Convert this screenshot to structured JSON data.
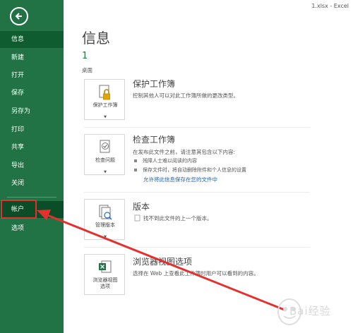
{
  "window": {
    "title": "1.xlsx - Excel"
  },
  "sidebar": {
    "items": [
      {
        "label": "信息"
      },
      {
        "label": "新建"
      },
      {
        "label": "打开"
      },
      {
        "label": "保存"
      },
      {
        "label": "另存为"
      },
      {
        "label": "打印"
      },
      {
        "label": "共享"
      },
      {
        "label": "导出"
      },
      {
        "label": "关闭"
      },
      {
        "label": "帐户"
      },
      {
        "label": "选项"
      }
    ]
  },
  "main": {
    "title": "信息",
    "file_name": "1",
    "file_location": "桌面",
    "sections": [
      {
        "button_label": "保护工作簿",
        "title": "保护工作簿",
        "description": "控制其他人可以对此工作簿所做的更改类型。"
      },
      {
        "button_label": "检查问题",
        "title": "检查工作簿",
        "description": "在发布此文件之前，请注意其包含以下内容:",
        "bullets": [
          "残障人士难以阅读的内容",
          "保存文件时，将自动删除附件和个人信息的设置"
        ],
        "link": "允许将此信息保存在您的文件中"
      },
      {
        "button_label": "管理版本",
        "title": "版本",
        "description": "找不到此文件的上一个版本。"
      },
      {
        "button_label_1": "浏览器视图",
        "button_label_2": "选项",
        "title": "浏览器视图选项",
        "description": "选择在 Web 上查看此工作簿时用户可以看到的内容。"
      }
    ]
  },
  "watermark": {
    "text": "Bai经验"
  },
  "colors": {
    "sidebar": "#217346",
    "annotation": "#e3312f",
    "link": "#1f5fa8"
  }
}
